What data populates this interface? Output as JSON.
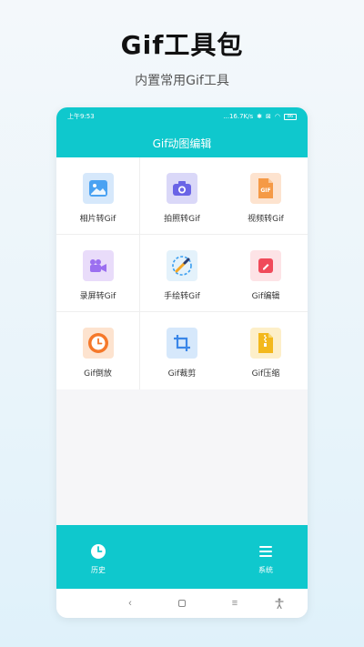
{
  "promo": {
    "title": "Gif工具包",
    "subtitle": "内置常用Gif工具"
  },
  "statusbar": {
    "time": "上午9:53",
    "network_speed": "...16.7K/s",
    "battery": "86"
  },
  "app": {
    "title": "Gif动图编辑"
  },
  "tools": [
    {
      "label": "相片转Gif",
      "icon": "image-icon",
      "bg": "#d6e8fb",
      "fg": "#4aa2f2"
    },
    {
      "label": "拍照转Gif",
      "icon": "camera-icon",
      "bg": "#dad8f8",
      "fg": "#6a64e6"
    },
    {
      "label": "视频转Gif",
      "icon": "gif-file-icon",
      "bg": "#fde3cf",
      "fg": "#f59a46"
    },
    {
      "label": "录屏转Gif",
      "icon": "video-camera-icon",
      "bg": "#e9dcfa",
      "fg": "#9b6ff0"
    },
    {
      "label": "手绘转Gif",
      "icon": "paintbrush-icon",
      "bg": "#e4f2fb",
      "fg": "#3a9ef0"
    },
    {
      "label": "Gif编辑",
      "icon": "edit-icon",
      "bg": "#fde3e6",
      "fg": "#f04a5a"
    },
    {
      "label": "Gif倒放",
      "icon": "clock-icon",
      "bg": "#fde3cf",
      "fg": "#f5782a"
    },
    {
      "label": "Gif裁剪",
      "icon": "crop-icon",
      "bg": "#d6e8fb",
      "fg": "#3a86e8"
    },
    {
      "label": "Gif压缩",
      "icon": "zip-file-icon",
      "bg": "#fdefc9",
      "fg": "#f3b81c"
    }
  ],
  "bottom_nav": {
    "history_label": "历史",
    "system_label": "系统"
  },
  "colors": {
    "accent": "#0fc8cd"
  }
}
